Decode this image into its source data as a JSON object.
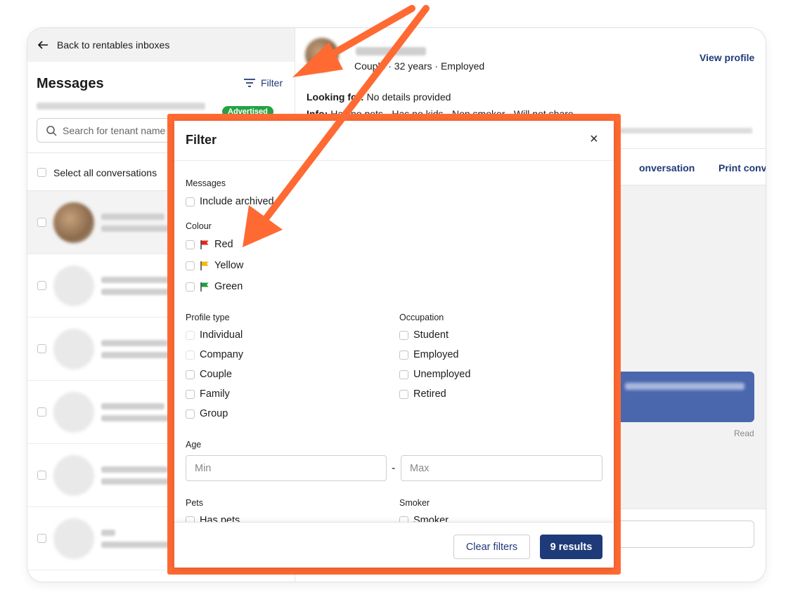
{
  "left": {
    "back_label": "Back to rentables inboxes",
    "title": "Messages",
    "filter_label": "Filter",
    "badge": "Advertised",
    "search_placeholder": "Search for tenant name",
    "select_all": "Select all conversations"
  },
  "profile": {
    "subtitle": "Couple · 32 years · Employed",
    "view_profile": "View profile",
    "looking_label": "Looking for:",
    "looking_value": "No details provided",
    "info_label": "Info:",
    "info_value": "Has no pets · Has no kids · Non smoker · Will not share"
  },
  "actions": {
    "conversation": "onversation",
    "print": "Print conversati"
  },
  "chat": {
    "read_label": "Read"
  },
  "filter": {
    "title": "Filter",
    "close": "×",
    "messages_label": "Messages",
    "include_archived": "Include archived",
    "colour_label": "Colour",
    "colours": [
      "Red",
      "Yellow",
      "Green"
    ],
    "colour_hex": [
      "#e0261b",
      "#f2b90c",
      "#1f9e3a"
    ],
    "profile_type_label": "Profile type",
    "profile_types": [
      "Individual",
      "Company",
      "Couple",
      "Family",
      "Group"
    ],
    "occupation_label": "Occupation",
    "occupations": [
      "Student",
      "Employed",
      "Unemployed",
      "Retired"
    ],
    "age_label": "Age",
    "age_min_placeholder": "Min",
    "age_max_placeholder": "Max",
    "age_separator": "-",
    "pets_label": "Pets",
    "has_pets": "Has pets",
    "smoker_label": "Smoker",
    "smoker": "Smoker",
    "clear_filters": "Clear filters",
    "results": "9 results"
  },
  "colors": {
    "accent": "#1f3a78",
    "annotation": "#ff6a33",
    "advertised_badge": "#25a244"
  }
}
